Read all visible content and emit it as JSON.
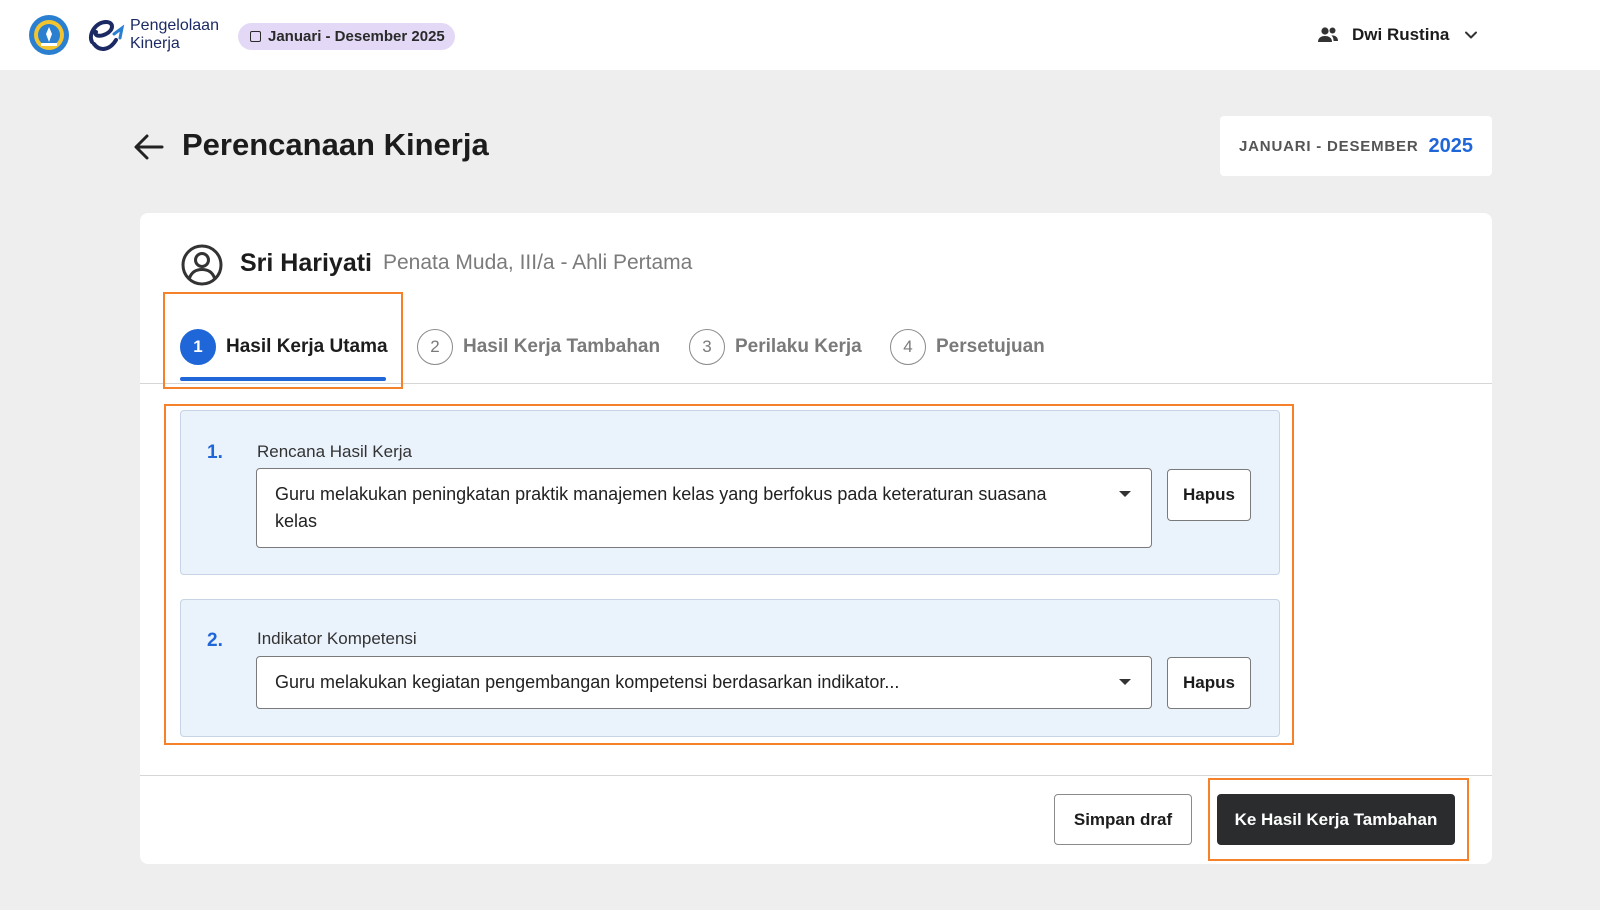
{
  "app": {
    "brand_line1": "Pengelolaan",
    "brand_line2": "Kinerja",
    "period_chip": "Januari - Desember 2025",
    "user_name": "Dwi Rustina"
  },
  "page": {
    "title": "Perencanaan Kinerja",
    "period_months": "JANUARI - DESEMBER",
    "period_year": "2025"
  },
  "employee": {
    "name": "Sri Hariyati",
    "rank": "Penata Muda, III/a - Ahli Pertama"
  },
  "steps": [
    {
      "number": "1",
      "label": "Hasil Kerja Utama",
      "active": true
    },
    {
      "number": "2",
      "label": "Hasil Kerja Tambahan",
      "active": false
    },
    {
      "number": "3",
      "label": "Perilaku Kerja",
      "active": false
    },
    {
      "number": "4",
      "label": "Persetujuan",
      "active": false
    }
  ],
  "items": [
    {
      "number": "1.",
      "label": "Rencana Hasil Kerja",
      "value": "Guru melakukan peningkatan praktik manajemen kelas yang berfokus pada keteraturan suasana kelas",
      "delete_label": "Hapus"
    },
    {
      "number": "2.",
      "label": "Indikator Kompetensi",
      "value": "Guru melakukan kegiatan pengembangan kompetensi berdasarkan indikator...",
      "delete_label": "Hapus"
    }
  ],
  "footer": {
    "save_draft_label": "Simpan draf",
    "next_label": "Ke Hasil Kerja Tambahan"
  },
  "colors": {
    "primary": "#1f66d8",
    "highlight": "#f5822a",
    "next_button": "#2a2c2e",
    "item_background": "#eaf2fc",
    "chip_background": "#e3d9f6"
  },
  "icons": {
    "emblem": "kemendikbud-emblem-icon",
    "brand": "e-kinerja-logo-icon",
    "user": "users-icon",
    "dropdown": "chevron-down-icon",
    "back": "arrow-left-icon",
    "avatar": "user-circle-icon"
  }
}
